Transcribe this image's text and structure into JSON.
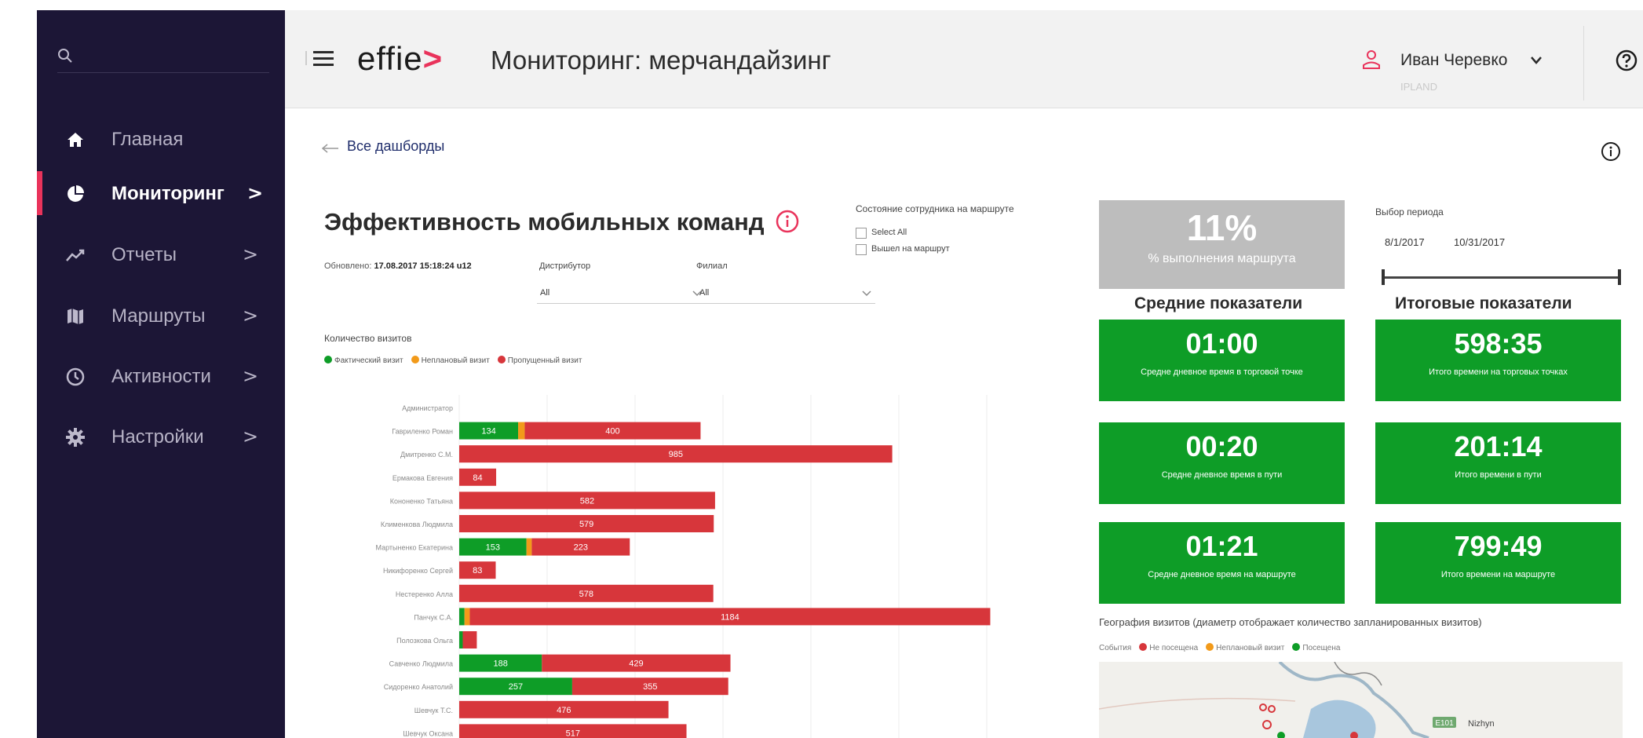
{
  "sidebar": {
    "items": [
      {
        "label": "Главная",
        "icon": "home-icon",
        "has_chevron": false
      },
      {
        "label": "Мониторинг",
        "icon": "pie-chart-icon",
        "has_chevron": true,
        "active": true
      },
      {
        "label": "Отчеты",
        "icon": "trend-icon",
        "has_chevron": true
      },
      {
        "label": "Маршруты",
        "icon": "map-icon",
        "has_chevron": true
      },
      {
        "label": "Активности",
        "icon": "clock-icon",
        "has_chevron": true
      },
      {
        "label": "Настройки",
        "icon": "gear-icon",
        "has_chevron": true
      }
    ],
    "chevron": ">"
  },
  "header": {
    "logo": "effie",
    "logo_mark": ">",
    "title": "Мониторинг: мерчандайзинг",
    "user_name": "Иван Черевко",
    "user_org": "IPLAND"
  },
  "nav": {
    "back_link": "Все дашборды"
  },
  "dashboard": {
    "title": "Эффективность мобильных команд",
    "updated_label": "Обновлено:",
    "updated_value": "17.08.2017 15:18:24 u12",
    "filters": {
      "distributor_label": "Дистрибутор",
      "distributor_value": "All",
      "branch_label": "Филиал",
      "branch_value": "All"
    },
    "employee_state": {
      "label": "Состояние сотрудника на маршруте",
      "options": [
        "Select All",
        "Вышел на маршрут"
      ]
    }
  },
  "chart_data": {
    "type": "bar",
    "title": "Количество визитов",
    "stacked": true,
    "orientation": "horizontal",
    "categories": [
      "Администратор",
      "Гавриленко Роман",
      "Дмитренко С.М.",
      "Ермакова Евгения",
      "Кононенко Татьяна",
      "Клименкова Людмила",
      "Мартыненко Екатерина",
      "Никифоренко Сергей",
      "Нестеренко Алла",
      "Панчук С.А.",
      "Полозкова Ольга",
      "Савченко Людмила",
      "Сидоренко Анатолий",
      "Шевчук Т.С.",
      "Шевчук Оксана"
    ],
    "series": [
      {
        "name": "Фактический визит",
        "color": "#0e9d27",
        "values": [
          0,
          134,
          0,
          0,
          0,
          0,
          153,
          0,
          0,
          12,
          8,
          188,
          257,
          0,
          0
        ],
        "labels": [
          "",
          "134",
          "",
          "",
          "",
          "",
          "153",
          "",
          "",
          "",
          "",
          "188",
          "257",
          "",
          ""
        ]
      },
      {
        "name": "Неплановый визит",
        "color": "#f29a1a",
        "values": [
          0,
          15,
          0,
          0,
          0,
          0,
          12,
          0,
          0,
          12,
          0,
          0,
          0,
          0,
          0
        ],
        "labels": [
          "",
          "",
          "",
          "",
          "",
          "",
          "",
          "",
          "",
          "",
          "",
          "",
          "",
          "",
          ""
        ]
      },
      {
        "name": "Пропущенный визит",
        "color": "#d7363b",
        "values": [
          0,
          400,
          985,
          84,
          582,
          579,
          223,
          83,
          578,
          1184,
          32,
          429,
          355,
          476,
          517
        ],
        "labels": [
          "",
          "400",
          "985",
          "84",
          "582",
          "579",
          "223",
          "83",
          "578",
          "1184",
          "",
          "429",
          "355",
          "476",
          "517"
        ]
      }
    ],
    "xlim": [
      0,
      1300
    ],
    "grid": true,
    "legend": "top-left"
  },
  "kpis": {
    "route_completion": {
      "value": "11%",
      "label": "% выполнения маршрута"
    },
    "period": {
      "label": "Выбор периода",
      "from": "8/1/2017",
      "to": "10/31/2017"
    },
    "avg_header": "Средние показатели",
    "total_header": "Итоговые показатели",
    "cards": [
      {
        "value": "01:00",
        "label": "Средне дневное время в торговой точке"
      },
      {
        "value": "598:35",
        "label": "Итого времени на торговых точках"
      },
      {
        "value": "00:20",
        "label": "Средне дневное время в пути"
      },
      {
        "value": "201:14",
        "label": "Итого времени в пути"
      },
      {
        "value": "01:21",
        "label": "Средне дневное время на маршруте"
      },
      {
        "value": "799:49",
        "label": "Итого времени на маршруте"
      }
    ]
  },
  "geo": {
    "title": "География визитов (диаметр отображает количество запланированных визитов)",
    "legend_label": "События",
    "legend": [
      {
        "label": "Не посещена",
        "color": "#d7363b"
      },
      {
        "label": "Неплановый визит",
        "color": "#f29a1a"
      },
      {
        "label": "Посещена",
        "color": "#0e9d27"
      }
    ],
    "map_labels": {
      "road": "E101",
      "city": "Nizhyn"
    }
  },
  "colors": {
    "sidebar_bg": "#1c1636",
    "accent": "#e9335b",
    "kpi_green": "#0e9d27",
    "kpi_gray": "#bdbdbd"
  }
}
